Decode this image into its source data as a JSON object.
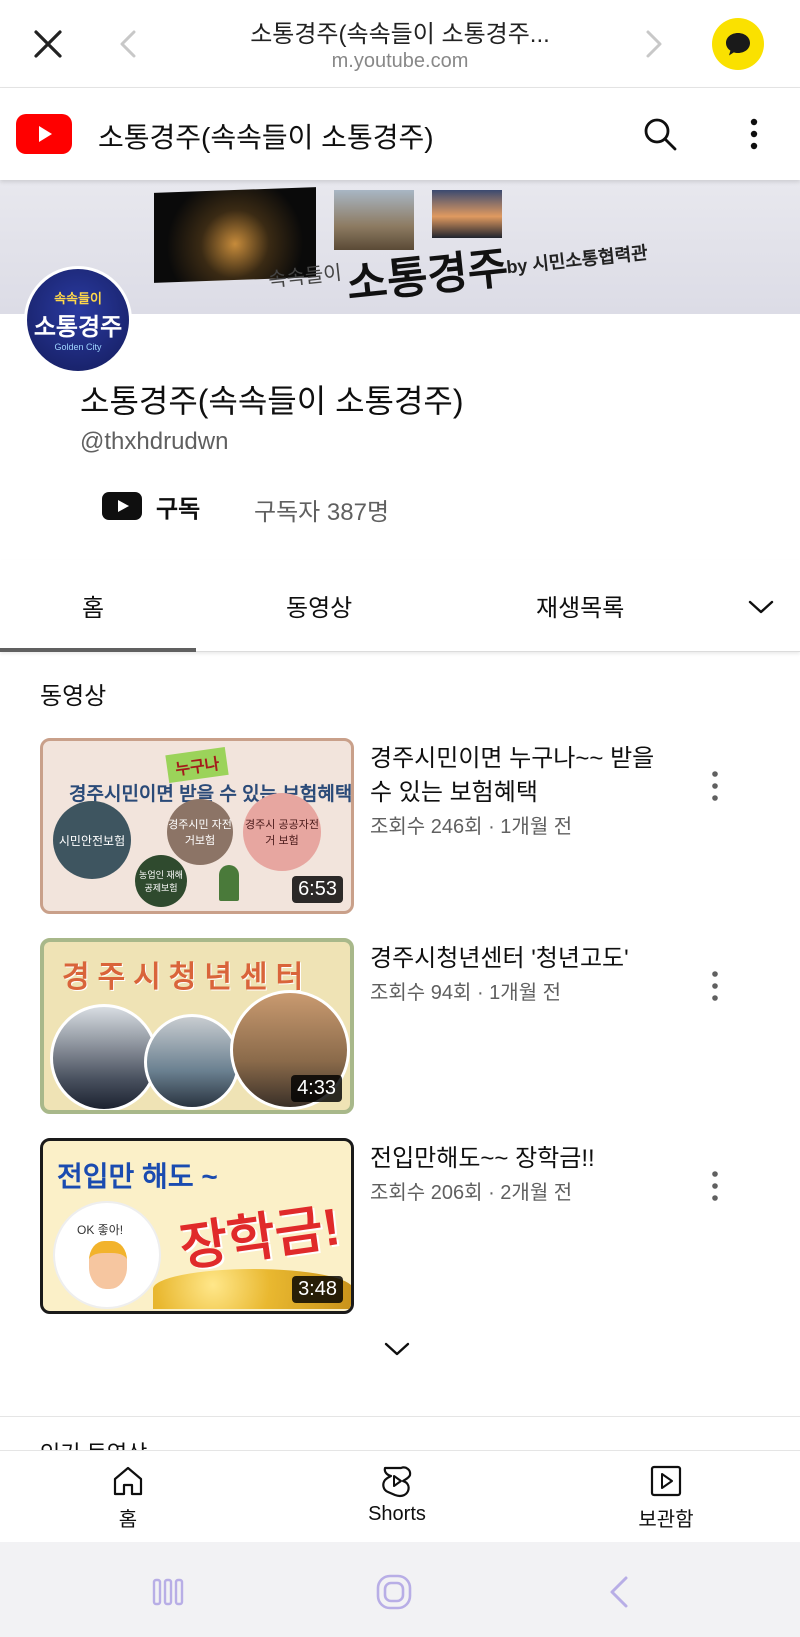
{
  "browser": {
    "title": "소통경주(속속들이 소통경주...",
    "url": "m.youtube.com"
  },
  "header": {
    "title": "소통경주(속속들이 소통경주)"
  },
  "banner": {
    "subtitle": "속속들이",
    "title": "소통경주",
    "byline": "by 시민소통협력관"
  },
  "avatar": {
    "line1": "속속들이",
    "line2": "소통경주",
    "line3": "Golden City"
  },
  "channel": {
    "name": "소통경주(속속들이 소통경주)",
    "handle": "@thxhdrudwn",
    "subscribe_label": "구독",
    "subscriber_count": "구독자 387명"
  },
  "tabs": [
    {
      "label": "홈",
      "active": true
    },
    {
      "label": "동영상",
      "active": false
    },
    {
      "label": "재생목록",
      "active": false
    }
  ],
  "section": {
    "title": "동영상",
    "next_title": "인기 동영상"
  },
  "videos": [
    {
      "title": "경주시민이면 누구나~~ 받을 수 있는 보험혜택",
      "meta": "조회수 246회 · 1개월 전",
      "duration": "6:53",
      "thumb": {
        "headline": "경주시민이면  받을 수 있는 보험혜택",
        "tag": "누구나",
        "c1": "시민안전보험",
        "c2": "경주시민 자전거보험",
        "c3": "경주시 공공자전거 보험",
        "c4": "농업인 재해공제보험"
      }
    },
    {
      "title": "경주시청년센터 '청년고도'",
      "meta": "조회수 94회 · 1개월 전",
      "duration": "4:33",
      "thumb": {
        "headline": "경주시청년센터"
      }
    },
    {
      "title": "전입만해도~~ 장학금!!",
      "meta": "조회수 206회 · 2개월 전",
      "duration": "3:48",
      "thumb": {
        "headline": "전입만 해도 ~",
        "big": "장학금!",
        "ok": "OK 좋아!"
      }
    }
  ],
  "bottom_nav": [
    {
      "label": "홈",
      "icon": "home-icon"
    },
    {
      "label": "Shorts",
      "icon": "shorts-icon"
    },
    {
      "label": "보관함",
      "icon": "library-icon"
    }
  ],
  "colors": {
    "youtube_red": "#ff0000",
    "kakao_yellow": "#fae100",
    "text_primary": "#0f0f0f",
    "text_secondary": "#606060"
  }
}
